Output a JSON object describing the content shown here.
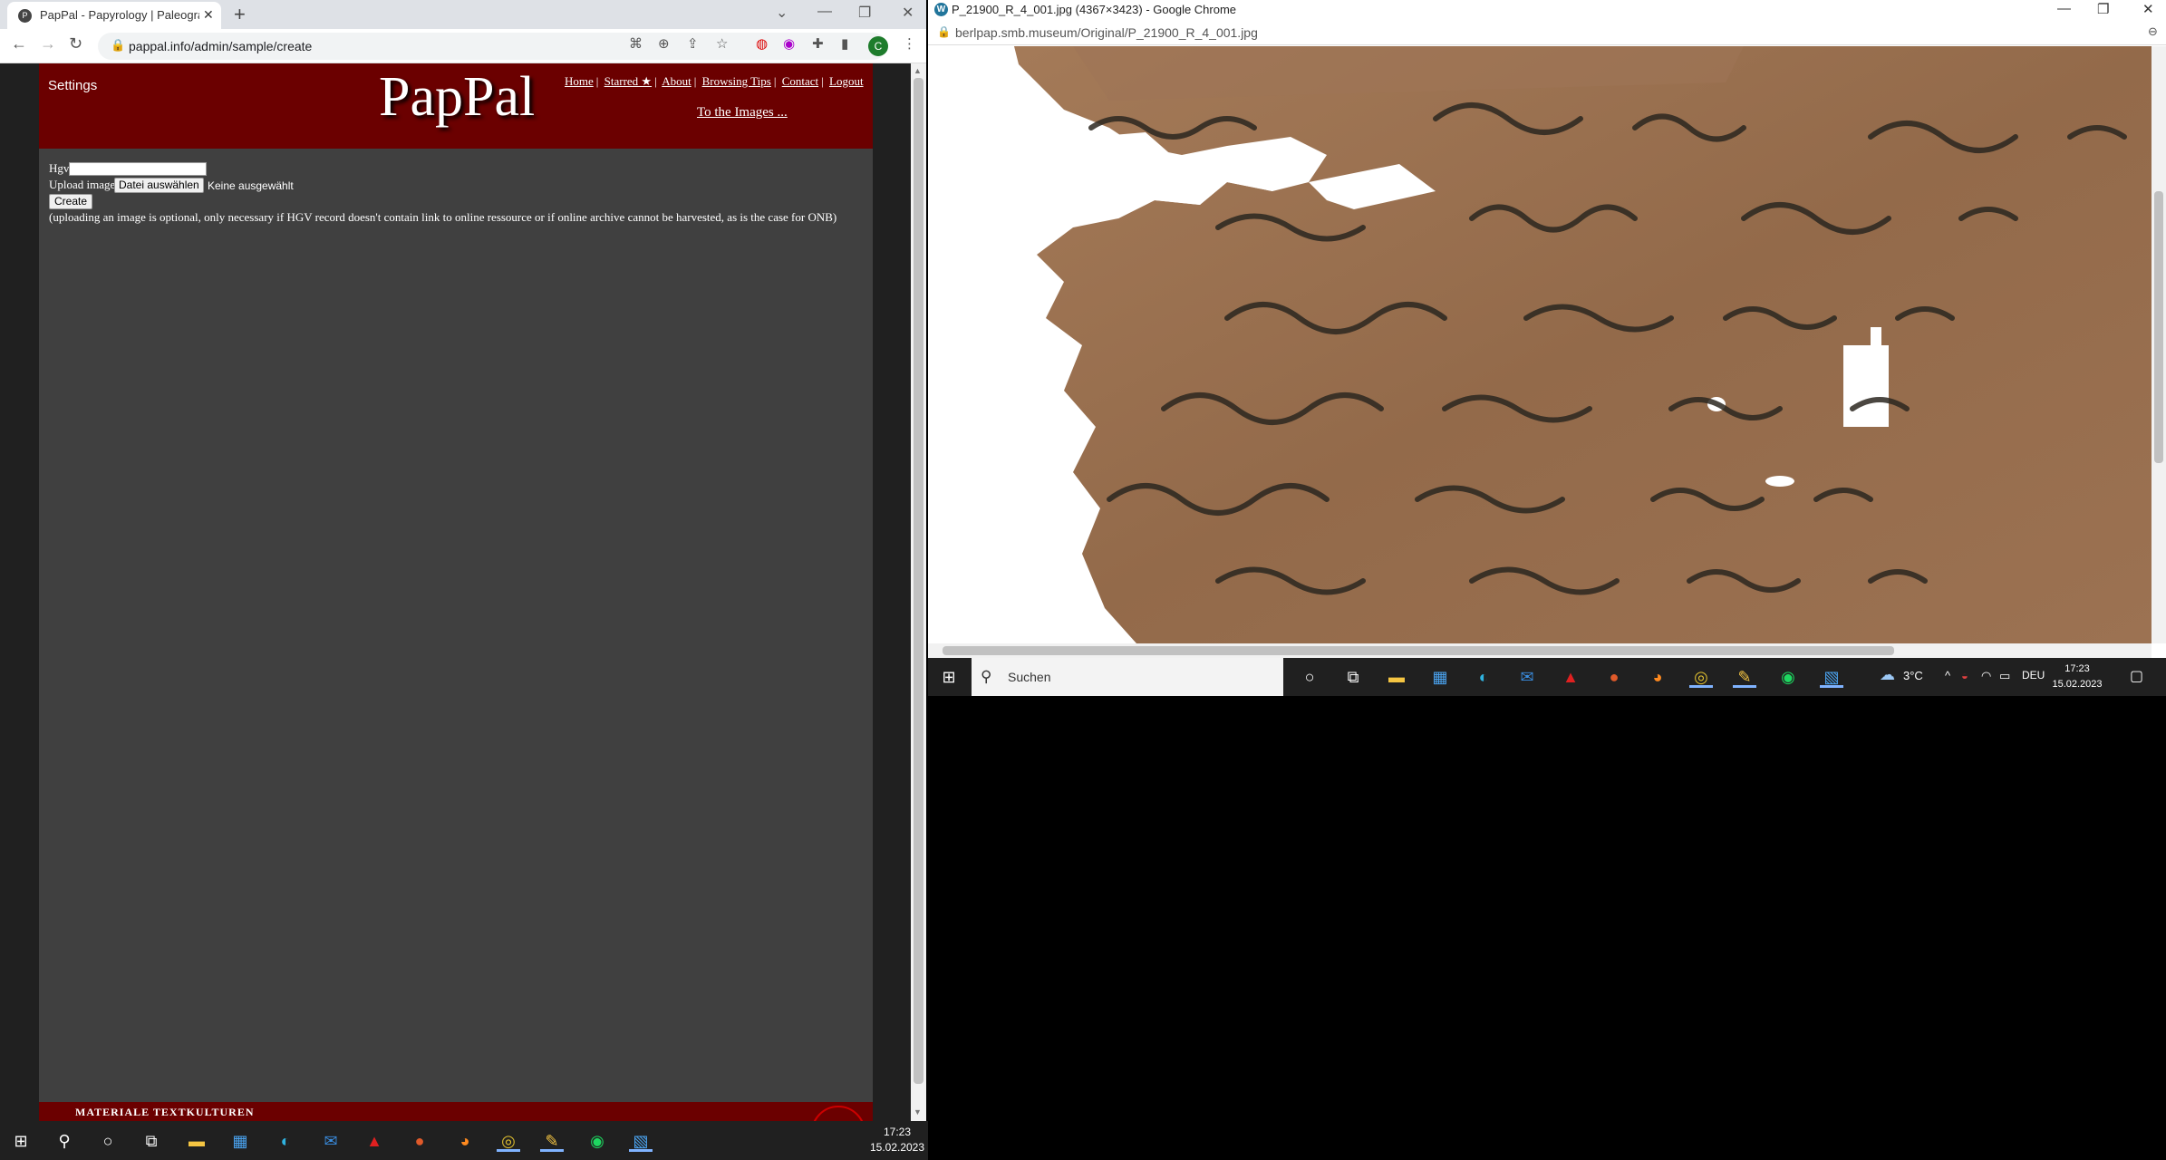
{
  "left_browser": {
    "tab_title": "PapPal - Papyrology | Paleograph",
    "url": "pappal.info/admin/sample/create",
    "profile_initial": "C"
  },
  "pappal": {
    "settings_label": "Settings",
    "logo": "PapPal",
    "nav": [
      "Home",
      "Starred ★",
      "About",
      "Browsing Tips",
      "Contact",
      "Logout"
    ],
    "to_images": "To the Images ...",
    "form": {
      "hgv_label": "Hgv",
      "hgv_value": "",
      "upload_label": "Upload image",
      "file_button": "Datei auswählen",
      "file_status": "Keine ausgewählt",
      "create_button": "Create",
      "note": "(uploading an image is optional, only necessary if HGV record doesn't contain link to online ressource or if online archive cannot be harvested, as is the case for ONB)"
    },
    "footer_text": "MATERIALE TEXTKULTUREN"
  },
  "left_taskbar": {
    "time": "17:23",
    "date": "15.02.2023"
  },
  "right_browser": {
    "title": "P_21900_R_4_001.jpg (4367×3423) - Google Chrome",
    "url": "berlpap.smb.museum/Original/P_21900_R_4_001.jpg"
  },
  "right_taskbar": {
    "search_placeholder": "Suchen",
    "weather": "3°C",
    "language": "DEU",
    "time": "17:23",
    "date": "15.02.2023"
  },
  "colors": {
    "header_red": "#6b0000",
    "page_gray": "#404040",
    "papyrus": "#9a6f4e",
    "ink": "#2b2720"
  }
}
